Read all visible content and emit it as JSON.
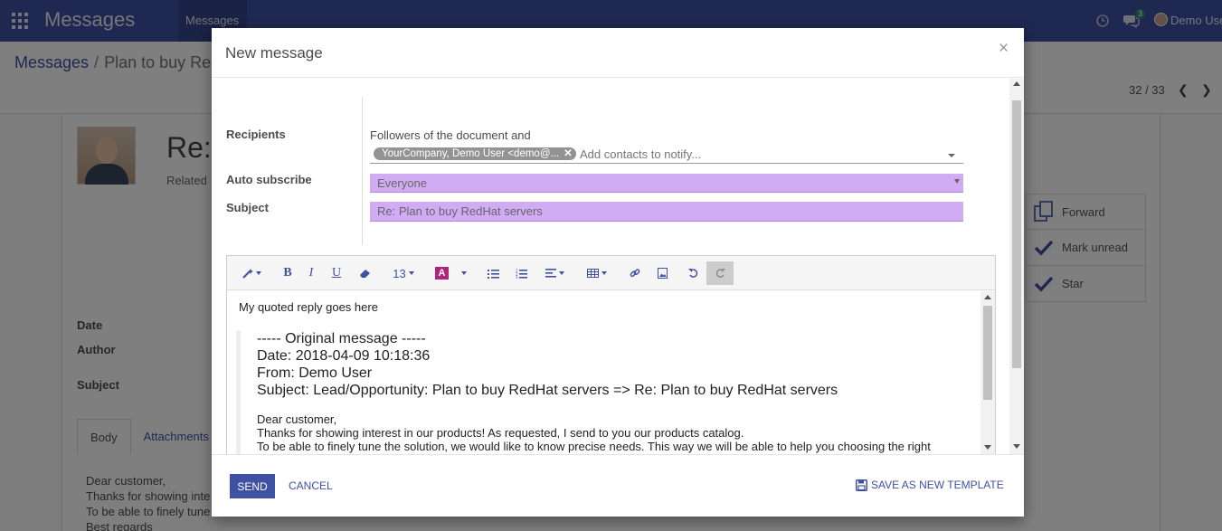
{
  "navbar": {
    "app_title": "Messages",
    "menu_item": "Messages",
    "chat_count": "3",
    "user_name": "Demo User"
  },
  "control": {
    "breadcrumb_root": "Messages",
    "breadcrumb_current": "Plan to buy Re",
    "pager": "32 / 33"
  },
  "background_form": {
    "title": "Re:",
    "related": "Related",
    "labels": {
      "date": "Date",
      "author": "Author",
      "subject": "Subject"
    },
    "side_buttons": {
      "forward": "Forward",
      "mark_unread": "Mark unread",
      "star": "Star"
    },
    "tabs": {
      "body": "Body",
      "attachments": "Attachments"
    },
    "body_text": "Dear customer,\nThanks for showing inte\nTo be able to finely tune\nBest regards"
  },
  "modal": {
    "title": "New message",
    "close": "×",
    "recipients_label": "Recipients",
    "followers_text": "Followers of the document and",
    "recipient_tag": "YourCompany, Demo User <demo@...",
    "recipients_placeholder": "Add contacts to notify...",
    "auto_subscribe_label": "Auto subscribe",
    "auto_subscribe_value": "Everyone",
    "subject_label": "Subject",
    "subject_value": "Re: Plan to buy RedHat servers",
    "toolbar": {
      "font_size": "13"
    },
    "editor": {
      "reply_line": "My quoted reply goes here",
      "quote_lines": [
        "----- Original message -----",
        "Date: 2018-04-09 10:18:36",
        "From: Demo User",
        "Subject: Lead/Opportunity: Plan to buy RedHat servers => Re: Plan to buy RedHat servers"
      ],
      "body_lines": [
        "Dear customer,",
        "Thanks for showing interest in our products! As requested, I send to you our products catalog.",
        "To be able to finely tune the solution, we would like to know precise needs. This way we will be able to help you choosing the right"
      ]
    },
    "footer": {
      "send": "SEND",
      "cancel": "CANCEL",
      "save_template": "SAVE AS NEW TEMPLATE"
    }
  },
  "colors": {
    "brand": "#3f51a3",
    "required_field": "#d2abf5",
    "tag_bg": "#939393"
  }
}
